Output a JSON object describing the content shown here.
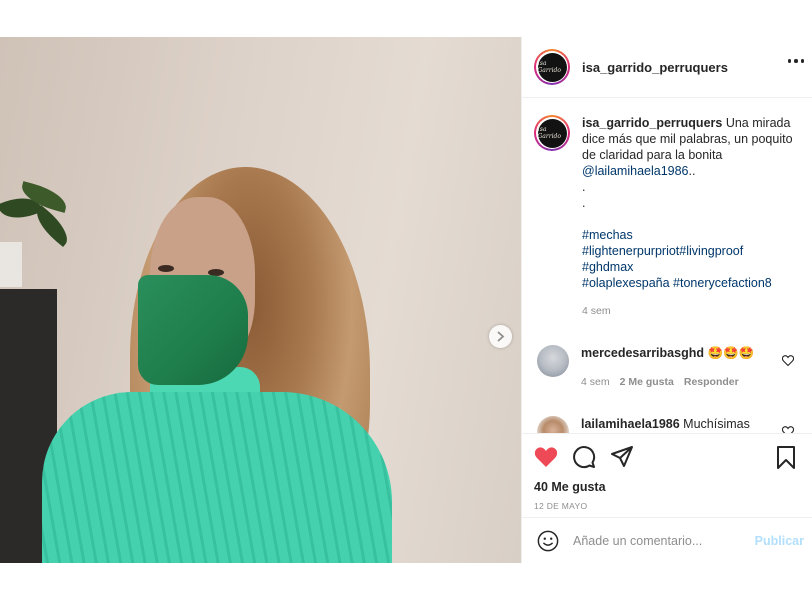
{
  "post": {
    "username": "isa_garrido_perruquers",
    "avatar_text": "Isa Garrido",
    "caption": {
      "username": "isa_garrido_perruquers",
      "text": "Una mirada dice más que mil palabras, un poquito de claridad para la bonita",
      "mention": "@lailamihaela1986",
      "mention_suffix": "..",
      "dot1": ".",
      "dot2": ".",
      "hashtags": [
        "#mechas",
        "#lightenerpurpriot#livingproof",
        "#ghdmax",
        "#olaplexespaña #tonerycefaction8"
      ],
      "time": "4 sem"
    },
    "comments": [
      {
        "username": "mercedesarribasghd",
        "text": "🤩🤩🤩",
        "time": "4 sem",
        "likes": "2 Me gusta",
        "reply": "Responder"
      },
      {
        "username": "lailamihaela1986",
        "text": "Muchísimas gracias corazón 🤩 🤩 🤩 🤩 🤩 🤩!!!!! Sois las mejores 😊😊",
        "time": "",
        "likes": "",
        "reply": ""
      }
    ],
    "like_count": "40 Me gusta",
    "date": "12 DE MAYO",
    "comment_placeholder": "Añade un comentario...",
    "publish_label": "Publicar",
    "carousel": {
      "total": 5,
      "active": 1
    }
  },
  "colors": {
    "like_red": "#ed4956",
    "link": "#00376b",
    "muted": "#8e8e8e",
    "publish_disabled": "#b2dffc"
  }
}
